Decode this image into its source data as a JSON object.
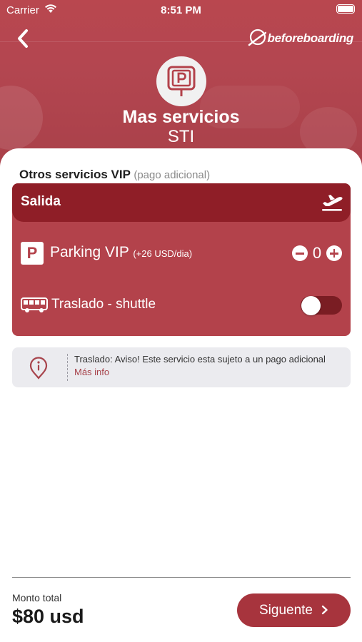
{
  "status_bar": {
    "carrier": "Carrier",
    "time": "8:51 PM"
  },
  "header": {
    "brand": "beforeboarding",
    "title": "Mas servicios",
    "subtitle": "STI",
    "icon": "parking-sign-icon"
  },
  "section": {
    "title": "Otros servicios VIP",
    "title_note": "(pago adicional)"
  },
  "card": {
    "title": "Salida",
    "title_icon": "plane-takeoff-icon",
    "parking": {
      "badge": "P",
      "label": "Parking VIP",
      "note": "(+26 USD/dia)",
      "quantity": "0"
    },
    "shuttle": {
      "label": "Traslado - shuttle",
      "icon": "bus-icon",
      "enabled": false
    }
  },
  "notice": {
    "icon": "info-pin-icon",
    "text": "Traslado: Aviso! Este servicio esta sujeto a un pago adicional",
    "link": "Más info"
  },
  "footer": {
    "total_label": "Monto total",
    "total_value": "$80 usd",
    "next_label": "Siguente"
  },
  "colors": {
    "brand": "#b3424b",
    "brand_dark": "#8f1e27",
    "button": "#a7343d"
  }
}
